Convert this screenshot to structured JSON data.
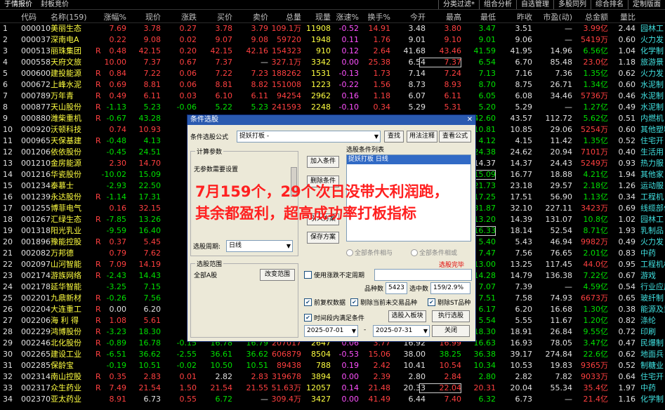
{
  "topbar": {
    "tabs": [
      "于情报价",
      "封板竞价"
    ],
    "right_tabs": [
      "分类过滤*",
      "组合分析",
      "自选管理",
      "多股同列",
      "综合排名",
      "定制版面"
    ]
  },
  "columns": [
    "代码",
    "名称(159)",
    "涨幅%",
    "现价",
    "涨跌",
    "买价",
    "卖价",
    "总量",
    "现量",
    "涨速%",
    "换手%",
    "今开",
    "最高",
    "最低",
    "昨收",
    "市盈(动)",
    "总金额",
    "量比",
    ""
  ],
  "rows": [
    {
      "n": "1",
      "code": "000010",
      "name": "美丽生态",
      "r": "",
      "v": [
        "7.69",
        "3.78",
        "0.27",
        "3.78",
        "3.79",
        "109.1万",
        "11908",
        "-0.52",
        "14.91",
        "3.48",
        "3.80",
        "3.47",
        "3.51",
        "—",
        "3.99亿",
        "2.44",
        "园林工"
      ]
    },
    {
      "n": "2",
      "code": "000037",
      "name": "深南电A",
      "r": "",
      "v": [
        "0.22",
        "9.08",
        "0.02",
        "9.07",
        "9.08",
        "59720",
        "1948",
        "0.11",
        "1.76",
        "9.01",
        "9.10",
        "9.01",
        "9.06",
        "—",
        "5419万",
        "0.60",
        "火力发"
      ]
    },
    {
      "n": "3",
      "code": "000513",
      "name": "丽珠集团",
      "r": "R",
      "v": [
        "0.48",
        "42.15",
        "0.20",
        "42.15",
        "42.16",
        "154323",
        "910",
        "0.12",
        "2.64",
        "41.68",
        "43.46",
        "41.59",
        "41.95",
        "14.96",
        "6.56亿",
        "1.04",
        "化学制"
      ]
    },
    {
      "n": "4",
      "code": "000558",
      "name": "天府文旅",
      "r": "",
      "v": [
        "10.00",
        "7.37",
        "0.67",
        "7.37",
        "—",
        "327.1万",
        "3342",
        "0.00",
        "25.38",
        "6.54",
        "7.37",
        "6.54",
        "6.70",
        "85.48",
        "23.0亿",
        "1.18",
        "旅游景"
      ]
    },
    {
      "n": "5",
      "code": "000600",
      "name": "建投能源",
      "r": "R",
      "v": [
        "0.84",
        "7.22",
        "0.06",
        "7.22",
        "7.23",
        "188262",
        "1531",
        "-0.13",
        "1.73",
        "7.14",
        "7.24",
        "7.13",
        "7.16",
        "7.36",
        "1.35亿",
        "0.62",
        "火力发"
      ]
    },
    {
      "n": "6",
      "code": "000672",
      "name": "上峰水泥",
      "r": "R",
      "v": [
        "0.69",
        "8.81",
        "0.06",
        "8.81",
        "8.82",
        "151008",
        "1223",
        "-0.22",
        "1.56",
        "8.73",
        "8.93",
        "8.70",
        "8.75",
        "26.71",
        "1.34亿",
        "0.60",
        "水泥制"
      ]
    },
    {
      "n": "7",
      "code": "000789",
      "name": "万年青",
      "r": "R",
      "v": [
        "0.49",
        "6.11",
        "0.03",
        "6.10",
        "6.11",
        "94254",
        "2962",
        "0.16",
        "1.18",
        "6.07",
        "6.11",
        "6.05",
        "6.08",
        "34.46",
        "5736万",
        "0.46",
        "水泥制"
      ]
    },
    {
      "n": "8",
      "code": "000877",
      "name": "天山股份",
      "r": "R",
      "v": [
        "-1.13",
        "5.23",
        "-0.06",
        "5.22",
        "5.23",
        "241593",
        "2248",
        "-0.10",
        "0.34",
        "5.29",
        "5.31",
        "5.20",
        "5.29",
        "—",
        "1.27亿",
        "0.49",
        "水泥制"
      ]
    },
    {
      "n": "9",
      "code": "000880",
      "name": "潍柴重机",
      "r": "R",
      "v": [
        "-0.67",
        "43.28",
        "",
        "",
        "",
        "",
        "",
        "",
        "",
        "",
        "",
        "42.60",
        "43.57",
        "112.72",
        "5.62亿",
        "0.51",
        "内燃机"
      ]
    },
    {
      "n": "10",
      "code": "000920",
      "name": "沃顿科技",
      "r": "",
      "v": [
        "0.74",
        "10.93",
        "",
        "",
        "",
        "",
        "",
        "",
        "",
        "",
        "",
        "10.81",
        "10.85",
        "29.06",
        "5254万",
        "0.60",
        "其他塑料"
      ]
    },
    {
      "n": "11",
      "code": "000965",
      "name": "天保基建",
      "r": "R",
      "v": [
        "-0.48",
        "4.13",
        "",
        "",
        "",
        "",
        "",
        "",
        "",
        "",
        "",
        "4.12",
        "4.15",
        "11.42",
        "1.35亿",
        "0.52",
        "住宅开"
      ]
    },
    {
      "n": "12",
      "code": "001206",
      "name": "依依股份",
      "r": "",
      "v": [
        "-0.45",
        "24.51",
        "",
        "",
        "",
        "",
        "",
        "",
        "",
        "",
        "",
        "24.38",
        "24.62",
        "20.94",
        "7101万",
        "0.40",
        "生活用"
      ]
    },
    {
      "n": "13",
      "code": "001210",
      "name": "金房能源",
      "r": "",
      "v": [
        "2.30",
        "14.70",
        "",
        "",
        "",
        "",
        "",
        "",
        "",
        "",
        "",
        "14.37",
        "14.37",
        "24.43",
        "5249万",
        "0.93",
        "热力服"
      ]
    },
    {
      "n": "14",
      "code": "001216",
      "name": "华瓷股份",
      "r": "",
      "v": [
        "-10.02",
        "15.09",
        "",
        "",
        "",
        "",
        "",
        "",
        "",
        "",
        "",
        "15.09",
        "16.77",
        "18.88",
        "4.21亿",
        "1.94",
        "其他家"
      ]
    },
    {
      "n": "15",
      "code": "001234",
      "name": "泰慕士",
      "r": "",
      "v": [
        "-2.93",
        "22.50",
        "",
        "",
        "",
        "",
        "",
        "",
        "",
        "",
        "",
        "21.73",
        "23.18",
        "29.57",
        "2.18亿",
        "1.26",
        "运动服"
      ]
    },
    {
      "n": "16",
      "code": "001239",
      "name": "永达股份",
      "r": "R",
      "v": [
        "-1.14",
        "17.31",
        "",
        "",
        "",
        "",
        "",
        "",
        "",
        "",
        "",
        "17.25",
        "17.51",
        "56.90",
        "1.13亿",
        "0.34",
        "工程机"
      ]
    },
    {
      "n": "17",
      "code": "001255",
      "name": "博菲电气",
      "r": "",
      "v": [
        "0.16",
        "32.15",
        "",
        "",
        "",
        "",
        "",
        "",
        "",
        "",
        "",
        "31.87",
        "32.10",
        "227.11",
        "3423万",
        "0.69",
        "线缆部件"
      ]
    },
    {
      "n": "18",
      "code": "001267",
      "name": "汇绿生态",
      "r": "R",
      "v": [
        "-7.85",
        "13.26",
        "",
        "",
        "",
        "",
        "",
        "",
        "",
        "",
        "",
        "13.20",
        "14.39",
        "131.07",
        "10.8亿",
        "1.02",
        "园林工"
      ]
    },
    {
      "n": "19",
      "code": "001318",
      "name": "阳光乳业",
      "r": "",
      "v": [
        "-9.59",
        "16.40",
        "",
        "",
        "",
        "",
        "",
        "",
        "",
        "",
        "",
        "16.33",
        "18.14",
        "52.54",
        "8.71亿",
        "1.93",
        "乳制品"
      ]
    },
    {
      "n": "20",
      "code": "001896",
      "name": "豫能控股",
      "r": "R",
      "v": [
        "0.37",
        "5.45",
        "",
        "",
        "",
        "",
        "",
        "",
        "",
        "",
        "",
        "5.40",
        "5.43",
        "46.94",
        "9982万",
        "0.49",
        "火力发"
      ]
    },
    {
      "n": "21",
      "code": "002082",
      "name": "万邦德",
      "r": "",
      "v": [
        "0.79",
        "7.62",
        "",
        "",
        "",
        "",
        "",
        "",
        "",
        "",
        "",
        "7.47",
        "7.56",
        "76.65",
        "2.01亿",
        "0.83",
        "中药"
      ]
    },
    {
      "n": "22",
      "code": "002097",
      "name": "山河智能",
      "r": "R",
      "v": [
        "7.09",
        "14.19",
        "",
        "",
        "",
        "",
        "",
        "",
        "",
        "",
        "",
        "13.00",
        "13.25",
        "117.45",
        "44.0亿",
        "0.95",
        "工程机械"
      ]
    },
    {
      "n": "23",
      "code": "002174",
      "name": "游族网络",
      "r": "R",
      "v": [
        "-2.43",
        "14.43",
        "",
        "",
        "",
        "",
        "",
        "",
        "",
        "",
        "",
        "14.28",
        "14.79",
        "136.38",
        "7.22亿",
        "0.67",
        "游戏"
      ]
    },
    {
      "n": "24",
      "code": "002178",
      "name": "延华智能",
      "r": "",
      "v": [
        "-3.25",
        "7.15",
        "",
        "",
        "",
        "",
        "",
        "",
        "",
        "",
        "",
        "7.07",
        "7.39",
        "—",
        "4.59亿",
        "0.54",
        "行业应用"
      ]
    },
    {
      "n": "25",
      "code": "002201",
      "name": "九鼎新材",
      "r": "R",
      "v": [
        "-0.26",
        "7.56",
        "",
        "",
        "",
        "",
        "",
        "",
        "",
        "",
        "",
        "7.51",
        "7.58",
        "74.93",
        "6673万",
        "0.65",
        "玻纤制"
      ]
    },
    {
      "n": "26",
      "code": "002204",
      "name": "大连重工",
      "r": "R",
      "v": [
        "0.00",
        "6.20",
        "",
        "",
        "",
        "",
        "",
        "",
        "",
        "",
        "",
        "6.17",
        "6.20",
        "16.68",
        "1.30亿",
        "0.38",
        "能源及重"
      ]
    },
    {
      "n": "27",
      "code": "002206",
      "name": "海 利 得",
      "r": "R",
      "v": [
        "1.08",
        "5.61",
        "",
        "",
        "",
        "",
        "",
        "",
        "",
        "",
        "",
        "5.54",
        "5.55",
        "11.67",
        "1.20亿",
        "0.82",
        "涤纶"
      ]
    },
    {
      "n": "28",
      "code": "002229",
      "name": "鸿博股份",
      "r": "R",
      "v": [
        "-3.23",
        "18.30",
        "",
        "",
        "",
        "",
        "",
        "",
        "",
        "",
        "",
        "18.30",
        "18.91",
        "26.84",
        "9.55亿",
        "0.72",
        "印刷"
      ]
    },
    {
      "n": "29",
      "code": "002246",
      "name": "北化股份",
      "r": "R",
      "v": [
        "-0.89",
        "16.78",
        "-0.15",
        "16.78",
        "16.79",
        "207017",
        "2647",
        "0.06",
        "3.77",
        "16.92",
        "16.99",
        "16.63",
        "16.93",
        "78.05",
        "3.47亿",
        "0.47",
        "民爆制"
      ]
    },
    {
      "n": "30",
      "code": "002265",
      "name": "建设工业",
      "r": "R",
      "v": [
        "-6.51",
        "36.62",
        "-2.55",
        "36.61",
        "36.62",
        "606879",
        "8504",
        "-0.53",
        "15.06",
        "38.00",
        "38.25",
        "36.38",
        "39.17",
        "274.84",
        "22.6亿",
        "0.62",
        "地面兵"
      ]
    },
    {
      "n": "31",
      "code": "002285",
      "name": "保龄宝",
      "r": "",
      "v": [
        "-0.19",
        "10.51",
        "-0.02",
        "10.50",
        "10.51",
        "89438",
        "788",
        "0.19",
        "2.42",
        "10.41",
        "10.54",
        "10.34",
        "10.53",
        "19.83",
        "9365万",
        "0.52",
        "制糖业"
      ]
    },
    {
      "n": "32",
      "code": "002314",
      "name": "南山控股",
      "r": "R",
      "v": [
        "0.35",
        "2.83",
        "0.01",
        "2.82",
        "2.83",
        "319678",
        "3894",
        "0.00",
        "2.39",
        "2.80",
        "2.84",
        "2.80",
        "2.82",
        "7.82",
        "9033万",
        "0.64",
        "住宅开"
      ]
    },
    {
      "n": "33",
      "code": "002317",
      "name": "众生药业",
      "r": "R",
      "v": [
        "7.49",
        "21.54",
        "1.50",
        "21.54",
        "21.55",
        "51.63万",
        "12057",
        "0.14",
        "21.48",
        "20.33",
        "22.04",
        "20.31",
        "20.04",
        "55.34",
        "35.4亿",
        "1.97",
        "中药"
      ]
    },
    {
      "n": "34",
      "code": "002370",
      "name": "亚太药业",
      "r": "",
      "v": [
        "8.91",
        "6.73",
        "0.55",
        "6.72",
        "—",
        "309.4万",
        "3427",
        "0.00",
        "41.49",
        "6.44",
        "7.40",
        "6.32",
        "6.73",
        "—",
        "21.4亿",
        "1.16",
        "化学制"
      ]
    }
  ],
  "dialog": {
    "title": "条件选股",
    "formula_label": "条件选股公式",
    "formula_value": "捉妖打板 -",
    "btn_find": "查找",
    "btn_usage": "用法注释",
    "btn_view": "查看公式",
    "calc_params": "计算参数",
    "no_params": "无参数需要设置",
    "btn_add": "加入条件",
    "btn_delete": "删除条件",
    "btn_read": "引入方案",
    "btn_save": "保存方案",
    "list_label": "选股条件列表",
    "list_item": "捉妖打板 日线",
    "period_label": "选股周期:",
    "period_value": "日线",
    "radio_and": "全部条件相与",
    "radio_or": "全部条件相或",
    "done_text": "选股完毕",
    "range_label": "选股范围",
    "range_value": "全部A股",
    "btn_range": "改变范围",
    "chk_uncertain": "使用涨跌不定周期",
    "total_label": "品种数",
    "total_value": "5423",
    "selected_label": "选中数",
    "selected_value": "159/2.9%",
    "chk_fq": "前复权数据",
    "chk_exclude": "剔除当前未交易品种",
    "chk_st": "剔除ST品种",
    "chk_time": "时间段内满足条件",
    "btn_into_board": "选股入板块",
    "btn_execute": "执行选股",
    "date_from": "2025-07-01",
    "date_to": "2025-07-31",
    "date_sep": "-",
    "btn_close": "关闭"
  },
  "overlay": {
    "line1": "7月159个，29个次日没带大利润跑，",
    "line2": "其余都盈利，超高成功率打板指标"
  }
}
